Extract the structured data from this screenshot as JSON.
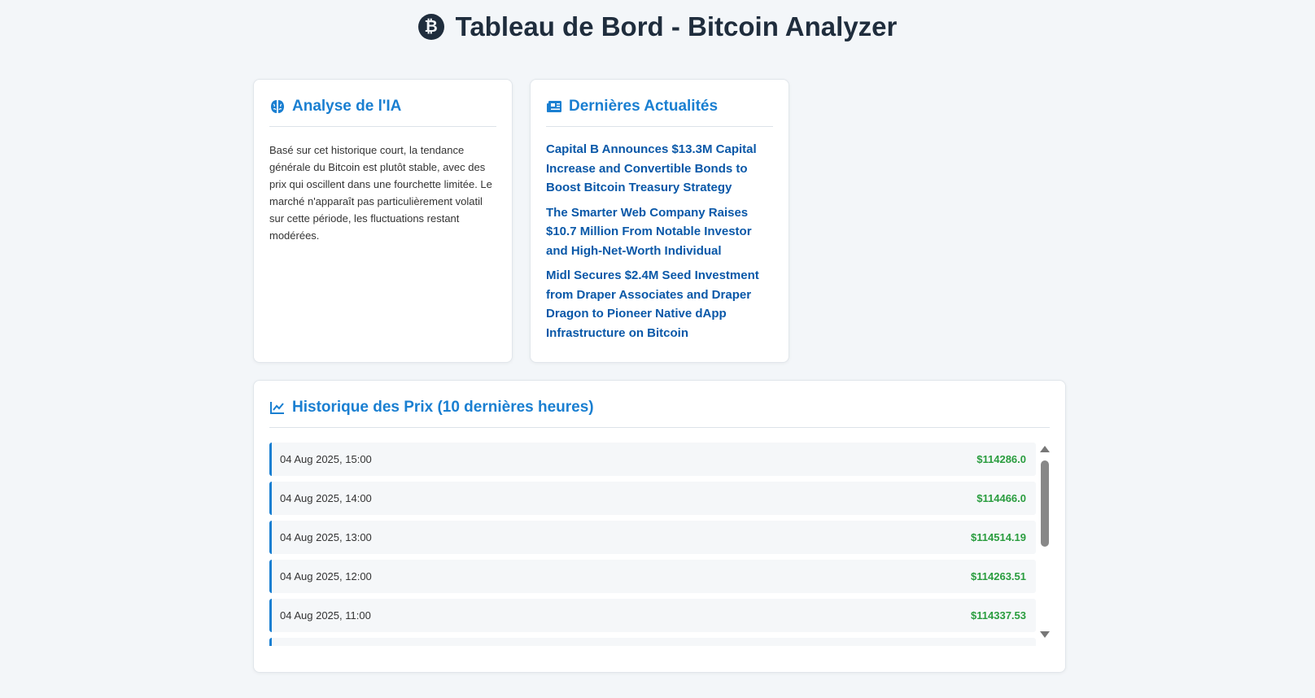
{
  "header": {
    "title": "Tableau de Bord - Bitcoin Analyzer",
    "icon": "bitcoin-icon",
    "icon_glyph": "₿"
  },
  "colors": {
    "accent": "#1a7fd1",
    "link": "#0a58a8",
    "price": "#2a9d3f",
    "title": "#1f2d3d"
  },
  "ai_card": {
    "title": "Analyse de l'IA",
    "icon": "brain-icon",
    "text": "Basé sur cet historique court, la tendance générale du Bitcoin est plutôt stable, avec des prix qui oscillent dans une fourchette limitée. Le marché n'apparaît pas particulièrement volatil sur cette période, les fluctuations restant modérées."
  },
  "news_card": {
    "title": "Dernières Actualités",
    "icon": "newspaper-icon",
    "items": [
      "Capital B Announces $13.3M Capital Increase and Convertible Bonds to Boost Bitcoin Treasury Strategy",
      "The Smarter Web Company Raises $10.7 Million From Notable Investor and High-Net-Worth Individual",
      "Midl Secures $2.4M Seed Investment from Draper Associates and Draper Dragon to Pioneer Native dApp Infrastructure on Bitcoin"
    ]
  },
  "history_card": {
    "title": "Historique des Prix (10 dernières heures)",
    "icon": "line-chart-icon",
    "rows": [
      {
        "date": "04 Aug 2025, 15:00",
        "price": "$114286.0"
      },
      {
        "date": "04 Aug 2025, 14:00",
        "price": "$114466.0"
      },
      {
        "date": "04 Aug 2025, 13:00",
        "price": "$114514.19"
      },
      {
        "date": "04 Aug 2025, 12:00",
        "price": "$114263.51"
      },
      {
        "date": "04 Aug 2025, 11:00",
        "price": "$114337.53"
      },
      {
        "date": "",
        "price": ""
      }
    ]
  }
}
